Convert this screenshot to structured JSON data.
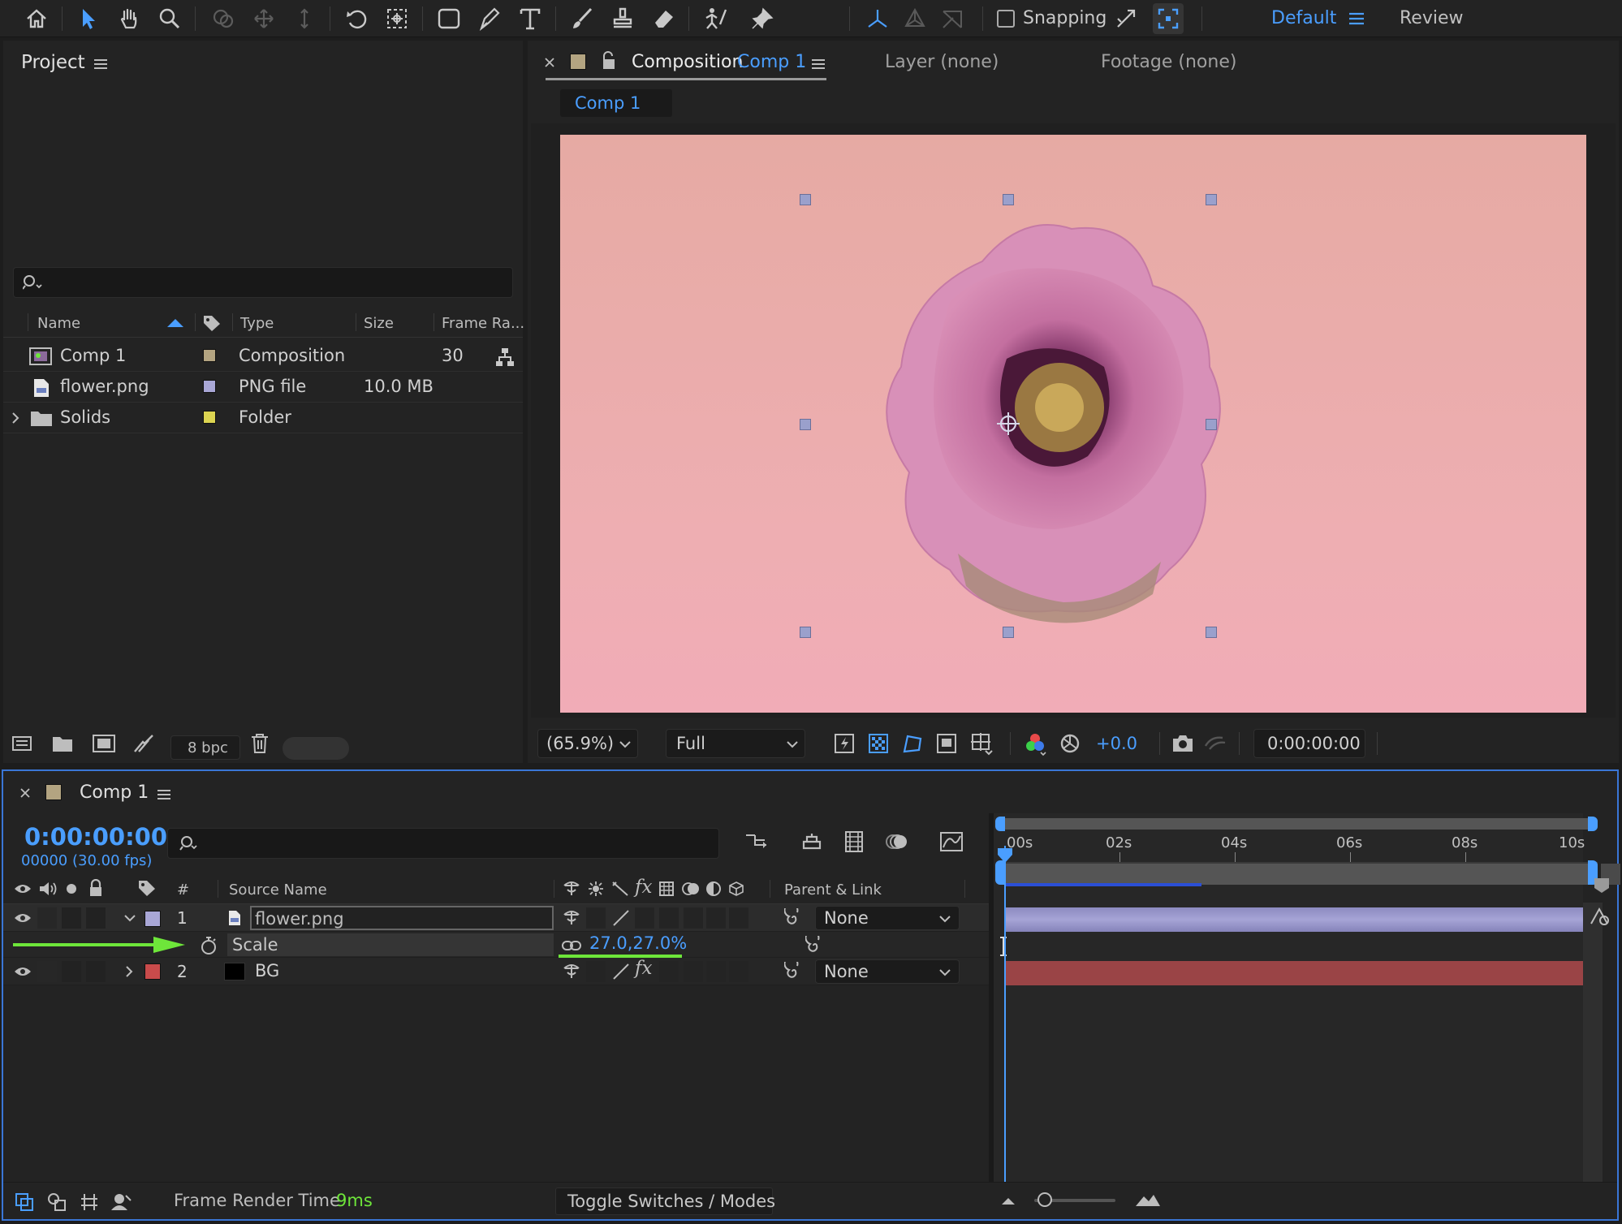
{
  "toolbar": {
    "snapping_label": "Snapping",
    "workspace_default": "Default",
    "workspace_review": "Review"
  },
  "project": {
    "title": "Project",
    "search_placeholder": "",
    "columns": {
      "name": "Name",
      "type": "Type",
      "size": "Size",
      "frame_rate": "Frame Ra..."
    },
    "items": [
      {
        "name": "Comp 1",
        "type": "Composition",
        "size": "",
        "frame_rate": "30",
        "color": "#b3a481"
      },
      {
        "name": "flower.png",
        "type": "PNG file",
        "size": "10.0 MB",
        "frame_rate": "",
        "color": "#a9a7d6"
      },
      {
        "name": "Solids",
        "type": "Folder",
        "size": "",
        "frame_rate": "",
        "color": "#dcd451"
      }
    ],
    "bpc_label": "8 bpc"
  },
  "viewer": {
    "tab_composition_prefix": "Composition",
    "tab_composition_name": "Comp 1",
    "tab_layer": "Layer (none)",
    "tab_footage": "Footage (none)",
    "breadcrumb": "Comp 1",
    "zoom": "(65.9%)",
    "resolution": "Full",
    "exposure": "+0.0",
    "timecode": "0:00:00:00"
  },
  "timeline": {
    "title": "Comp 1",
    "current_time": "0:00:00:00",
    "frame_info": "00000 (30.00 fps)",
    "search_placeholder": "",
    "headers": {
      "number": "#",
      "source_name": "Source Name",
      "parent_link": "Parent & Link"
    },
    "ruler": [
      "00s",
      "02s",
      "04s",
      "06s",
      "08s",
      "10s"
    ],
    "layers": [
      {
        "num": "1",
        "name": "flower.png",
        "parent": "None",
        "color": "#a9a7d6"
      },
      {
        "num": "2",
        "name": "BG",
        "parent": "None",
        "color": "#c94b4b"
      }
    ],
    "property": {
      "name": "Scale",
      "value": "27.0,27.0%"
    },
    "status_label": "Frame Render Time",
    "status_value": "9ms",
    "toggle_label": "Toggle Switches / Modes"
  },
  "colors": {
    "accent": "#4a9eff",
    "green": "#6ee63a"
  }
}
